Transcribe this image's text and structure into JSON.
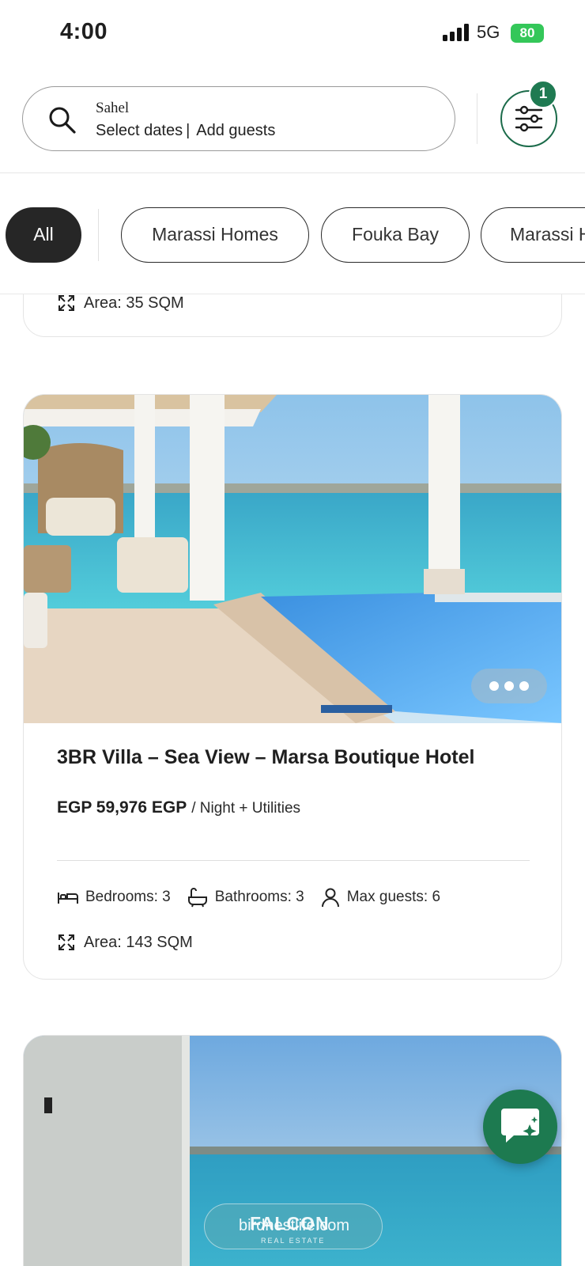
{
  "status_bar": {
    "time": "4:00",
    "network": "5G",
    "battery": "80"
  },
  "search": {
    "location": "Sahel",
    "dates": "Select dates",
    "separator": "|",
    "guests": "Add guests"
  },
  "filter": {
    "badge_count": "1"
  },
  "categories": [
    {
      "label": "All",
      "active": true
    },
    {
      "label": "Marassi Homes",
      "active": false
    },
    {
      "label": "Fouka Bay",
      "active": false
    },
    {
      "label": "Marassi H",
      "active": false
    }
  ],
  "previous_listing": {
    "area": "Area: 35 SQM"
  },
  "listing": {
    "title": "3BR Villa – Sea View – Marsa Boutique Hotel",
    "price": "EGP 59,976 EGP",
    "price_unit": "/ Night + Utilities",
    "bedrooms": "Bedrooms: 3",
    "bathrooms": "Bathrooms: 3",
    "max_guests": "Max guests: 6",
    "area": "Area: 143 SQM"
  },
  "next_listing": {
    "watermark": "birdnestlife.com",
    "brand": "FALCON",
    "brand_sub": "REAL ESTATE"
  },
  "colors": {
    "brand_green": "#1d7a50",
    "chip_active": "#262626",
    "battery_green": "#34c759"
  },
  "icons": [
    "search-icon",
    "filter-sliders-icon",
    "bed-icon",
    "bathtub-icon",
    "user-icon",
    "area-expand-icon",
    "more-dots-icon",
    "chat-sparkle-icon"
  ]
}
